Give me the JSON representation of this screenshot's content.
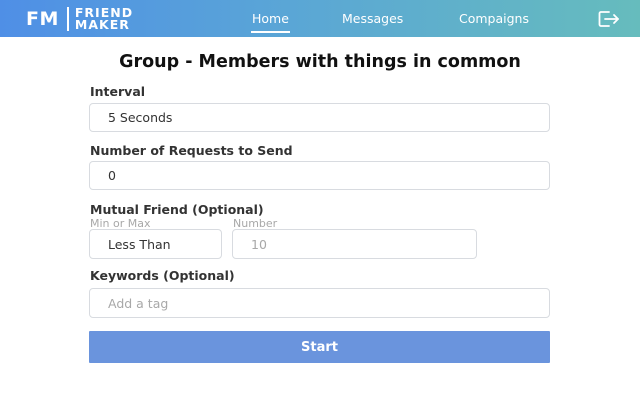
{
  "header": {
    "logo_mark": "FM",
    "logo_word_1": "FRIEND",
    "logo_word_2": "MAKER",
    "nav": {
      "home": "Home",
      "messages": "Messages",
      "campaigns": "Compaigns"
    },
    "active_tab": "Home",
    "logout_icon": "logout-icon"
  },
  "page": {
    "title": "Group - Members with things in common"
  },
  "form": {
    "interval": {
      "label": "Interval",
      "value": "5 Seconds"
    },
    "requests": {
      "label": "Number of Requests to Send",
      "value": "0"
    },
    "mutual": {
      "label": "Mutual Friend (Optional)",
      "min_max_label": "Min or Max",
      "min_max_value": "Less Than",
      "number_label": "Number",
      "number_placeholder": "10"
    },
    "keywords": {
      "label": "Keywords (Optional)",
      "placeholder": "Add a tag"
    },
    "start_label": "Start"
  },
  "colors": {
    "header_gradient_start": "#4f8fe6",
    "header_gradient_end": "#66bcbd",
    "button": "#6a94dd"
  }
}
